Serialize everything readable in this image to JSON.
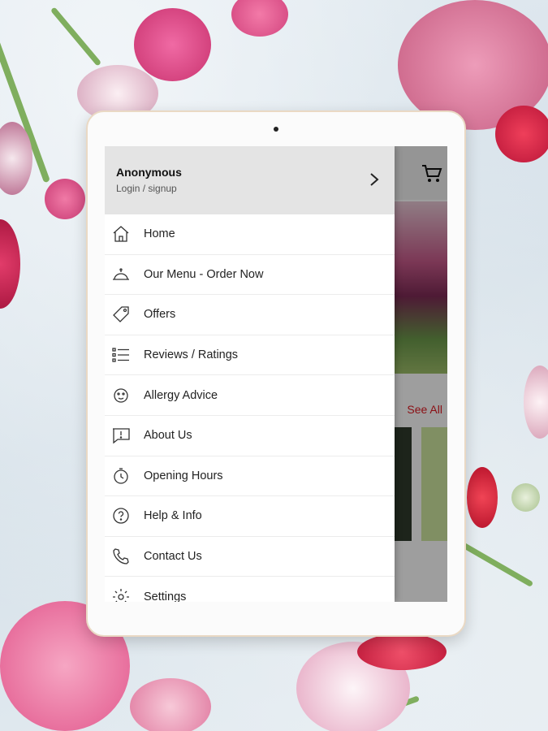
{
  "drawer": {
    "user": {
      "name": "Anonymous",
      "subtitle": "Login / signup"
    },
    "items": [
      {
        "label": "Home",
        "icon": "home-icon"
      },
      {
        "label": "Our Menu - Order Now",
        "icon": "cloche-icon"
      },
      {
        "label": "Offers",
        "icon": "tag-icon"
      },
      {
        "label": "Reviews / Ratings",
        "icon": "list-rating-icon"
      },
      {
        "label": "Allergy Advice",
        "icon": "allergy-icon"
      },
      {
        "label": "About Us",
        "icon": "info-message-icon"
      },
      {
        "label": "Opening Hours",
        "icon": "clock-icon"
      },
      {
        "label": "Help & Info",
        "icon": "help-icon"
      },
      {
        "label": "Contact Us",
        "icon": "phone-icon"
      },
      {
        "label": "Settings",
        "icon": "gear-icon"
      }
    ]
  },
  "app": {
    "see_all": "See All"
  },
  "colors": {
    "accent": "#e01b22",
    "drawer_header": "#e4e4e4"
  }
}
